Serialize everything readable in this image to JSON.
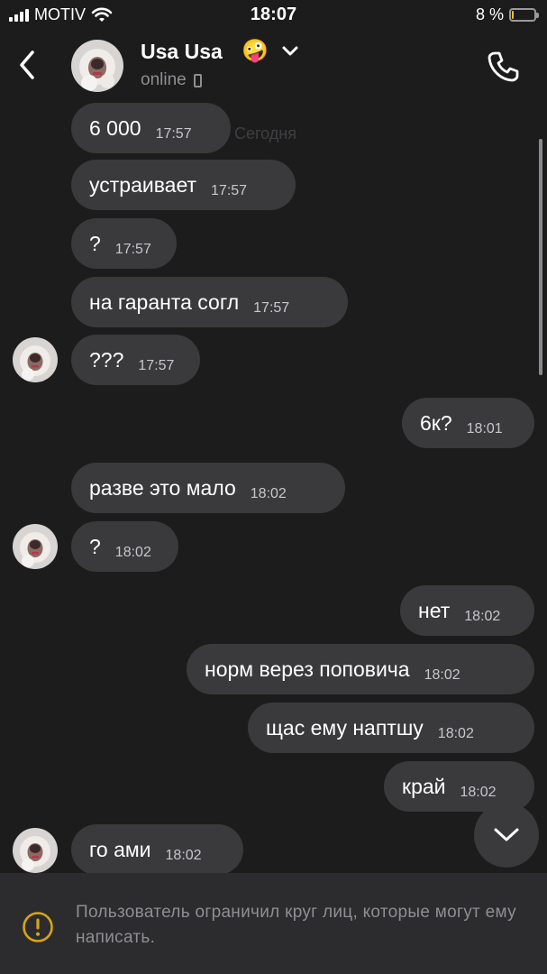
{
  "status_bar": {
    "carrier": "MOTIV",
    "time": "18:07",
    "battery_text": "8 %",
    "battery_level": 0.08,
    "battery_color": "#f2c21b"
  },
  "header": {
    "back_icon": "chevron-left-icon",
    "name": "Usa Usa",
    "emoji": "🤪",
    "presence": "online",
    "dropdown_icon": "chevron-down-icon",
    "call_icon": "phone-icon"
  },
  "messages": {
    "date_divider": "Сегодня",
    "items": [
      {
        "text": "6 000",
        "time": "17:57",
        "side": "in"
      },
      {
        "text": "устраивает",
        "time": "17:57",
        "side": "in"
      },
      {
        "text": "?",
        "time": "17:57",
        "side": "in"
      },
      {
        "text": "на гаранта согл",
        "time": "17:57",
        "side": "in"
      },
      {
        "text": "???",
        "time": "17:57",
        "side": "in"
      },
      {
        "text": "6к?",
        "time": "18:01",
        "side": "out"
      },
      {
        "text": "разве это мало",
        "time": "18:02",
        "side": "in"
      },
      {
        "text": "?",
        "time": "18:02",
        "side": "in"
      },
      {
        "text": "нет",
        "time": "18:02",
        "side": "out"
      },
      {
        "text": "норм верез поповича",
        "time": "18:02",
        "side": "out"
      },
      {
        "text": "щас ему наптшу",
        "time": "18:02",
        "side": "out"
      },
      {
        "text": "край",
        "time": "18:02",
        "side": "out"
      },
      {
        "text": "го ами",
        "time": "18:02",
        "side": "in"
      }
    ]
  },
  "footer": {
    "warning_icon": "exclamation-circle-icon",
    "restriction_text": "Пользователь ограничил круг лиц, которые могут ему написать.",
    "accent_color": "#d9a514"
  },
  "colors": {
    "background": "#1c1c1d",
    "bubble": "#3a3a3c",
    "footer_bg": "#2c2c2e",
    "secondary_text": "#8e8e93"
  }
}
